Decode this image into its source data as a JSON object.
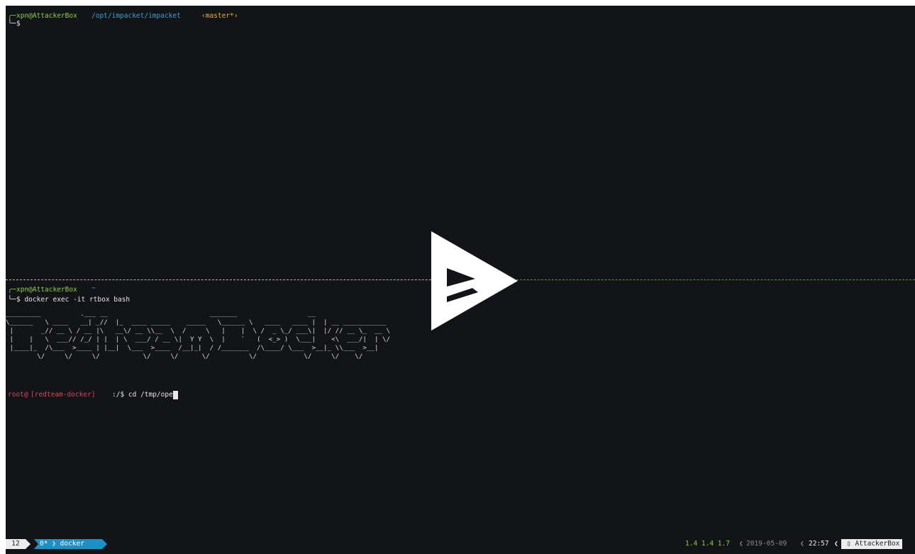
{
  "top_pane": {
    "prompt_user": "xpn@AttackerBox",
    "prompt_path": "/opt/impacket/impacket",
    "prompt_git": "‹master*›",
    "prompt_char": "$"
  },
  "bottom_pane": {
    "prompt_user": "xpn@AttackerBox",
    "prompt_path": "~",
    "command": "$ docker exec -it rtbox bash",
    "banner": "_________          .___ __                          _______                  __\n\\______   \\ ____   __| _//  |_  ____ _____    _____   \\______ \\   ____   ____ |  | __ ___________\n |       _// __ \\ / __ |\\   __\\/ __ \\\\__  \\  /     \\   |    |  \\ /  _ \\_/ ___\\|  |/ // __ \\_  __ \\\n |    |   \\  ___// /_/ | |  | \\  ___/ / __ \\|  Y Y  \\  |    `   (  <_> )  \\___|    <\\  ___/|  | \\/\n |____|_  /\\___  >____ | |__|  \\___  >____  /__|_|  / /_______  /\\____/ \\___  >__|_ \\\\___  >__|\n        \\/     \\/     \\/           \\/     \\/      \\/          \\/            \\/     \\/    \\/",
    "root_user": "root@",
    "root_host": "[redteam-docker]",
    "root_cmd": ":/$ cd /tmp/ope"
  },
  "status_bar": {
    "session": "12",
    "window_index": "0*",
    "window_name": "docker",
    "load": "1.4 1.4 1.7",
    "date": "2019-05-09",
    "time": "22:57",
    "hostname": "AttackerBox"
  },
  "colors": {
    "background": "#131417",
    "prompt_green": "#8ccf4b",
    "path_blue": "#3aa3d8",
    "git_yellow": "#e8b33a",
    "root_red": "#d9455f",
    "statusbar_blue": "#1d8fc4"
  }
}
